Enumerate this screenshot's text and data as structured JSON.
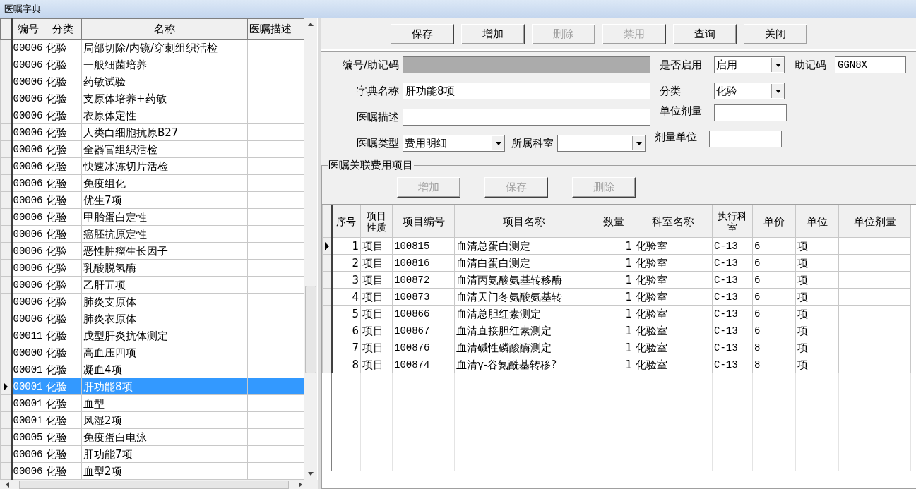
{
  "window": {
    "title": "医嘱字典"
  },
  "dictionary_grid": {
    "columns": [
      "编号",
      "分类",
      "名称",
      "医嘱描述"
    ],
    "rows": [
      {
        "code": "00006",
        "category": "化验",
        "name": "局部切除/内镜/穿刺组织活检",
        "selected": false
      },
      {
        "code": "00006",
        "category": "化验",
        "name": "一般细菌培养",
        "selected": false
      },
      {
        "code": "00006",
        "category": "化验",
        "name": "药敏试验",
        "selected": false
      },
      {
        "code": "00006",
        "category": "化验",
        "name": "支原体培养+药敏",
        "selected": false
      },
      {
        "code": "00006",
        "category": "化验",
        "name": "衣原体定性",
        "selected": false
      },
      {
        "code": "00006",
        "category": "化验",
        "name": "人类白细胞抗原B27",
        "selected": false
      },
      {
        "code": "00006",
        "category": "化验",
        "name": "全器官组织活检",
        "selected": false
      },
      {
        "code": "00006",
        "category": "化验",
        "name": "快速冰冻切片活检",
        "selected": false
      },
      {
        "code": "00006",
        "category": "化验",
        "name": "免疫组化",
        "selected": false
      },
      {
        "code": "00006",
        "category": "化验",
        "name": "优生7项",
        "selected": false
      },
      {
        "code": "00006",
        "category": "化验",
        "name": "甲胎蛋白定性",
        "selected": false
      },
      {
        "code": "00006",
        "category": "化验",
        "name": "癌胚抗原定性",
        "selected": false
      },
      {
        "code": "00006",
        "category": "化验",
        "name": "恶性肿瘤生长因子",
        "selected": false
      },
      {
        "code": "00006",
        "category": "化验",
        "name": "乳酸脱氢酶",
        "selected": false
      },
      {
        "code": "00006",
        "category": "化验",
        "name": "乙肝五项",
        "selected": false
      },
      {
        "code": "00006",
        "category": "化验",
        "name": "肺炎支原体",
        "selected": false
      },
      {
        "code": "00006",
        "category": "化验",
        "name": "肺炎衣原体",
        "selected": false
      },
      {
        "code": "00011",
        "category": "化验",
        "name": "戊型肝炎抗体测定",
        "selected": false
      },
      {
        "code": "00000",
        "category": "化验",
        "name": "高血压四项",
        "selected": false
      },
      {
        "code": "00001",
        "category": "化验",
        "name": "凝血4项",
        "selected": false
      },
      {
        "code": "00001",
        "category": "化验",
        "name": "肝功能8项",
        "selected": true
      },
      {
        "code": "00001",
        "category": "化验",
        "name": "血型",
        "selected": false
      },
      {
        "code": "00001",
        "category": "化验",
        "name": "风湿2项",
        "selected": false
      },
      {
        "code": "00005",
        "category": "化验",
        "name": "免疫蛋白电泳",
        "selected": false
      },
      {
        "code": "00006",
        "category": "化验",
        "name": "肝功能7项",
        "selected": false
      },
      {
        "code": "00006",
        "category": "化验",
        "name": "血型2项",
        "selected": false
      }
    ]
  },
  "toolbar": [
    {
      "label": "保存",
      "disabled": false
    },
    {
      "label": "增加",
      "disabled": false
    },
    {
      "label": "删除",
      "disabled": true
    },
    {
      "label": "禁用",
      "disabled": true
    },
    {
      "label": "查询",
      "disabled": false
    },
    {
      "label": "关闭",
      "disabled": false
    }
  ],
  "form": {
    "code": {
      "label": "编号/助记码",
      "disabled": true
    },
    "enabled": {
      "label": "是否启用",
      "value": "启用"
    },
    "mnemonic": {
      "label": "助记码",
      "value": "GGN8X"
    },
    "name": {
      "label": "字典名称",
      "value": "肝功能8项"
    },
    "category": {
      "label": "分类",
      "value": "化验"
    },
    "description": {
      "label": "医嘱描述"
    },
    "unit_dose": {
      "label": "单位剂量"
    },
    "order_type": {
      "label": "医嘱类型",
      "value": "费用明细"
    },
    "department": {
      "label": "所属科室"
    },
    "dose_unit": {
      "label": "剂量单位"
    }
  },
  "fee_items": {
    "title": "医嘱关联费用项目",
    "buttons": [
      {
        "label": "增加",
        "disabled": true
      },
      {
        "label": "保存",
        "disabled": true
      },
      {
        "label": "删除",
        "disabled": true
      }
    ],
    "columns": [
      "序号",
      "项目性质",
      "项目编号",
      "项目名称",
      "数量",
      "科室名称",
      "执行科室",
      "单价",
      "单位",
      "单位剂量"
    ],
    "rows": [
      {
        "no": "1",
        "nature": "项目",
        "item_code": "100815",
        "item_name": "血清总蛋白测定",
        "quantity": "1",
        "department": "化验室",
        "exec_department": "C-13",
        "price": "6",
        "unit": "项",
        "selected": true
      },
      {
        "no": "2",
        "nature": "项目",
        "item_code": "100816",
        "item_name": "血清白蛋白测定",
        "quantity": "1",
        "department": "化验室",
        "exec_department": "C-13",
        "price": "6",
        "unit": "项",
        "selected": false
      },
      {
        "no": "3",
        "nature": "项目",
        "item_code": "100872",
        "item_name": "血清丙氨酸氨基转移酶",
        "quantity": "1",
        "department": "化验室",
        "exec_department": "C-13",
        "price": "6",
        "unit": "项",
        "selected": false
      },
      {
        "no": "4",
        "nature": "项目",
        "item_code": "100873",
        "item_name": "血清天门冬氨酸氨基转",
        "quantity": "1",
        "department": "化验室",
        "exec_department": "C-13",
        "price": "6",
        "unit": "项",
        "selected": false
      },
      {
        "no": "5",
        "nature": "项目",
        "item_code": "100866",
        "item_name": "血清总胆红素测定",
        "quantity": "1",
        "department": "化验室",
        "exec_department": "C-13",
        "price": "6",
        "unit": "项",
        "selected": false
      },
      {
        "no": "6",
        "nature": "项目",
        "item_code": "100867",
        "item_name": "血清直接胆红素测定",
        "quantity": "1",
        "department": "化验室",
        "exec_department": "C-13",
        "price": "6",
        "unit": "项",
        "selected": false
      },
      {
        "no": "7",
        "nature": "项目",
        "item_code": "100876",
        "item_name": "血清碱性磷酸酶测定",
        "quantity": "1",
        "department": "化验室",
        "exec_department": "C-13",
        "price": "8",
        "unit": "项",
        "selected": false
      },
      {
        "no": "8",
        "nature": "项目",
        "item_code": "100874",
        "item_name": "血清γ-谷氨酰基转移?",
        "quantity": "1",
        "department": "化验室",
        "exec_department": "C-13",
        "price": "8",
        "unit": "项",
        "selected": false
      }
    ]
  }
}
